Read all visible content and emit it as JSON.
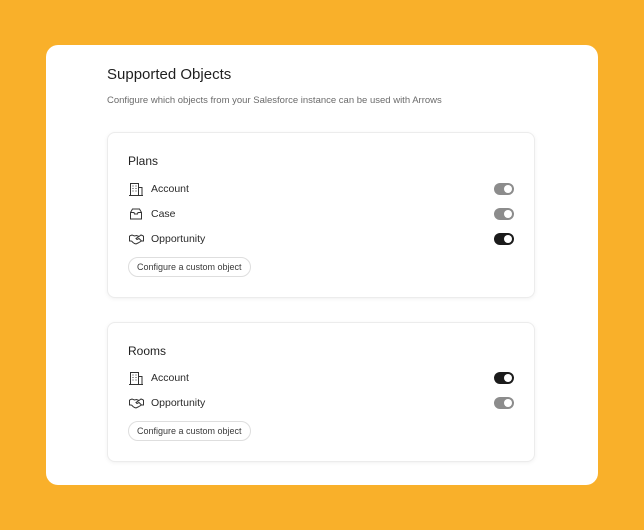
{
  "header": {
    "title": "Supported Objects",
    "subtitle": "Configure which objects from your Salesforce instance can be used with Arrows"
  },
  "cards": [
    {
      "title": "Plans",
      "items": [
        {
          "label": "Account",
          "icon": "building-icon",
          "enabled": false
        },
        {
          "label": "Case",
          "icon": "inbox-icon",
          "enabled": false
        },
        {
          "label": "Opportunity",
          "icon": "handshake-icon",
          "enabled": true
        }
      ],
      "custom_button": "Configure a custom object"
    },
    {
      "title": "Rooms",
      "items": [
        {
          "label": "Account",
          "icon": "building-icon",
          "enabled": true
        },
        {
          "label": "Opportunity",
          "icon": "handshake-icon",
          "enabled": false
        }
      ],
      "custom_button": "Configure a custom object"
    }
  ],
  "colors": {
    "background": "#F9B02A",
    "toggle_on": "#1B1B1B",
    "toggle_off": "#8C8C8C"
  }
}
